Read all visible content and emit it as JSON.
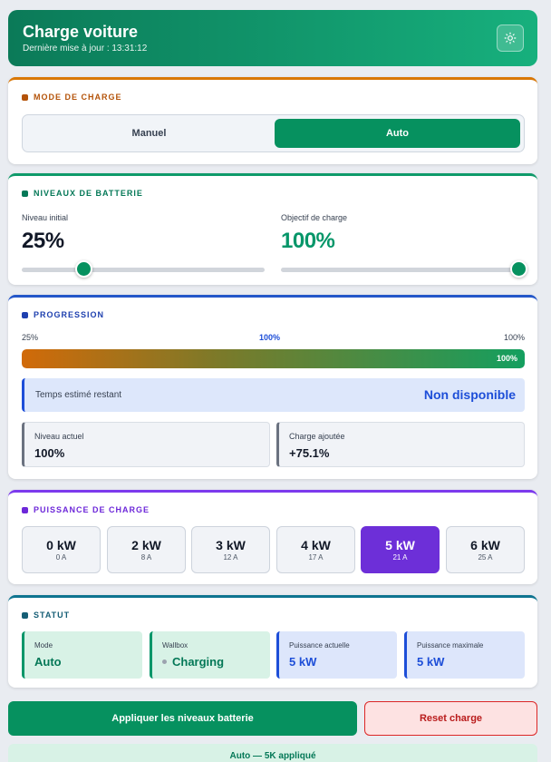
{
  "header": {
    "title": "Charge voiture",
    "last_update": "Dernière mise à jour : 13:31:12",
    "theme_icon": "sun-icon"
  },
  "mode": {
    "title": "MODE DE CHARGE",
    "options": [
      "Manuel",
      "Auto"
    ],
    "selected": "Auto",
    "accent": "#b45309"
  },
  "battery": {
    "title": "NIVEAUX DE BATTERIE",
    "initial_label": "Niveau initial",
    "initial_value": "25%",
    "initial_level": 25,
    "target_label": "Objectif de charge",
    "target_value": "100%",
    "target_level": 100,
    "accent": "#047857"
  },
  "progress": {
    "title": "PROGRESSION",
    "tick_start": "25%",
    "tick_current": "100%",
    "tick_end": "100%",
    "bar_label": "100%",
    "fill_percent": 100,
    "eta_label": "Temps estimé restant",
    "eta_value": "Non disponible",
    "current_level_label": "Niveau actuel",
    "current_level_value": "100%",
    "added_label": "Charge ajoutée",
    "added_value": "+75.1%",
    "accent": "#1e40af"
  },
  "power": {
    "title": "PUISSANCE DE CHARGE",
    "options": [
      {
        "kw": "0 kW",
        "amps": "0 A"
      },
      {
        "kw": "2 kW",
        "amps": "8 A"
      },
      {
        "kw": "3 kW",
        "amps": "12 A"
      },
      {
        "kw": "4 kW",
        "amps": "17 A"
      },
      {
        "kw": "5 kW",
        "amps": "21 A"
      },
      {
        "kw": "6 kW",
        "amps": "25 A"
      }
    ],
    "selected_index": 4,
    "accent": "#6d28d9"
  },
  "status": {
    "title": "STATUT",
    "mode_label": "Mode",
    "mode_value": "Auto",
    "wallbox_label": "Wallbox",
    "wallbox_value": "Charging",
    "current_power_label": "Puissance actuelle",
    "current_power_value": "5 kW",
    "max_power_label": "Puissance maximale",
    "max_power_value": "5 kW",
    "accent": "#155e75"
  },
  "actions": {
    "apply_label": "Appliquer les niveaux batterie",
    "reset_label": "Reset charge"
  },
  "toast": {
    "message": "Auto — 5K appliqué"
  }
}
